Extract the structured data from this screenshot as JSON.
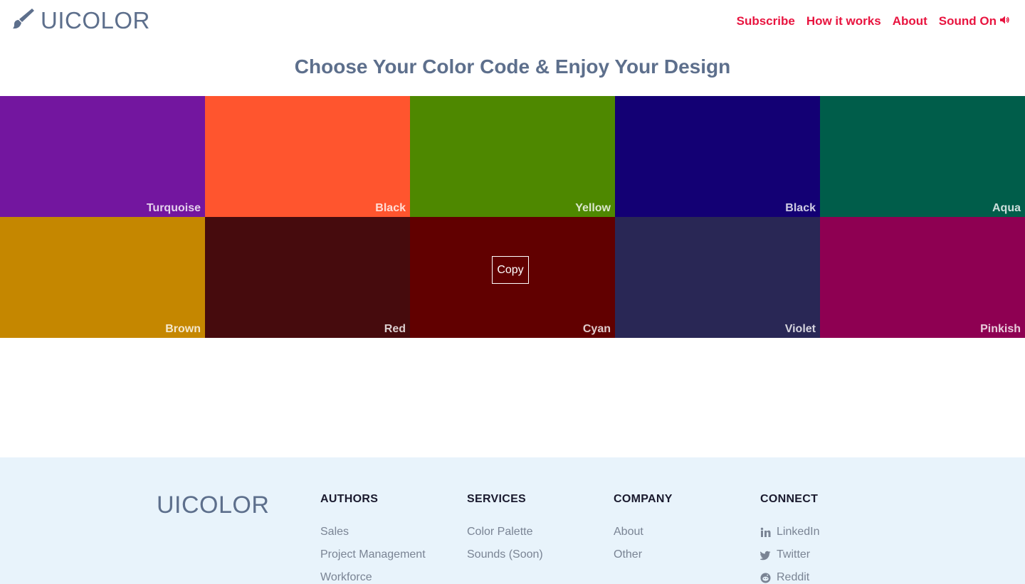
{
  "brand": {
    "name": "UICOLOR",
    "icon": "paintbrush-icon"
  },
  "nav": {
    "subscribe": "Subscribe",
    "how_it_works": "How it works",
    "about": "About",
    "sound": "Sound On",
    "sound_icon": "speaker-icon"
  },
  "headline": "Choose Your Color Code & Enjoy Your Design",
  "swatches": [
    {
      "name": "Turquoise",
      "color": "#73169f"
    },
    {
      "name": "Black",
      "color": "#ff552e"
    },
    {
      "name": "Yellow",
      "color": "#4e8800"
    },
    {
      "name": "Black",
      "color": "#130074"
    },
    {
      "name": "Aqua",
      "color": "#005d4a"
    },
    {
      "name": "Brown",
      "color": "#c58700"
    },
    {
      "name": "Red",
      "color": "#460b0d"
    },
    {
      "name": "Cyan",
      "color": "#610000"
    },
    {
      "name": "Violet",
      "color": "#292755"
    },
    {
      "name": "Pinkish",
      "color": "#8e0052"
    }
  ],
  "copy_label": "Copy",
  "footer": {
    "brand": "UICOLOR",
    "authors": {
      "title": "AUTHORS",
      "items": [
        "Sales",
        "Project Management",
        "Workforce"
      ]
    },
    "services": {
      "title": "SERVICES",
      "items": [
        "Color Palette",
        "Sounds (Soon)"
      ]
    },
    "company": {
      "title": "COMPANY",
      "items": [
        "About",
        "Other"
      ]
    },
    "connect": {
      "title": "CONNECT",
      "items": [
        {
          "label": "LinkedIn",
          "icon": "linkedin-icon"
        },
        {
          "label": "Twitter",
          "icon": "twitter-icon"
        },
        {
          "label": "Reddit",
          "icon": "reddit-icon"
        }
      ]
    }
  },
  "colors": {
    "brand_text": "#5d6f8c",
    "nav_link": "#e8143f",
    "footer_bg": "#e8f3fb"
  }
}
